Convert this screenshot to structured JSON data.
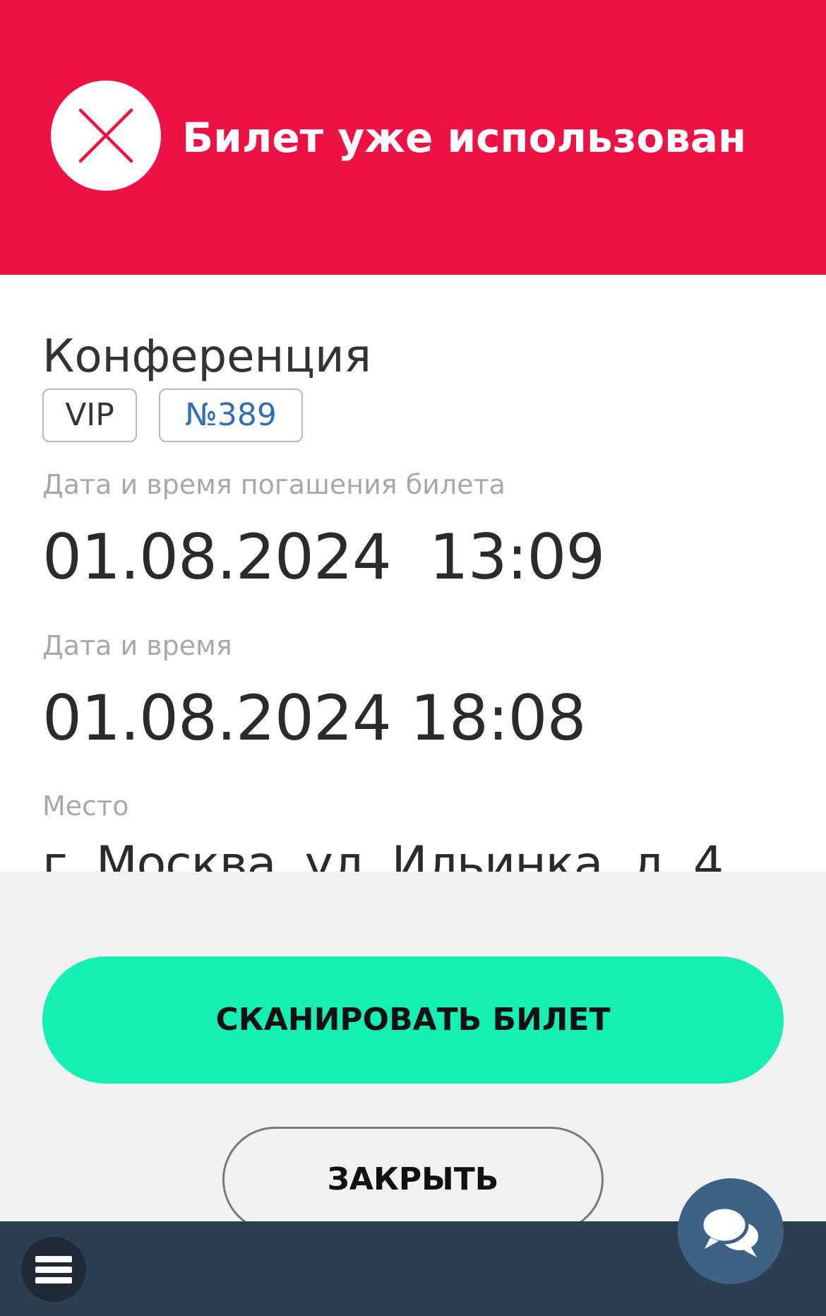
{
  "header": {
    "status_title": "Билет уже использован",
    "status_icon": "close-x-icon",
    "background_color": "#ee1144"
  },
  "ticket": {
    "event_name": "Конференция",
    "category_tag": "VIP",
    "number_tag": "№389",
    "fields": {
      "redeemed_label": "Дата и время погашения билета",
      "redeemed_value": "01.08.2024  13:09",
      "datetime_label": "Дата и время",
      "datetime_value": "01.08.2024 18:08",
      "place_label": "Место",
      "place_value": "г. Москва, ул. Ильинка, д. 4"
    }
  },
  "actions": {
    "scan_label": "СКАНИРОВАТЬ БИЛЕТ",
    "scan_color": "#14f0b4",
    "close_label": "ЗАКРЫТЬ"
  },
  "nav": {
    "menu_icon": "hamburger-menu-icon",
    "chat_icon": "chat-bubbles-icon",
    "background_color": "#2d3e50"
  }
}
